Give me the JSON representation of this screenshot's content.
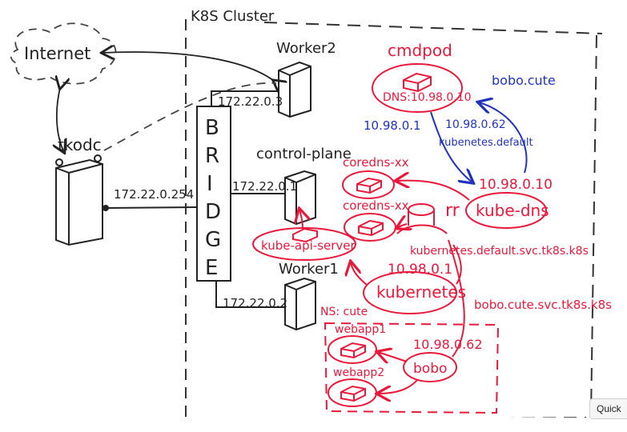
{
  "colors": {
    "ink": "#222222",
    "red": "#e8193c",
    "blue": "#2233bb",
    "dash": "#333333"
  },
  "cluster_label": "K8S Cluster",
  "internet": "Internet",
  "host": "tkodc",
  "host_ip": "172.22.0.254",
  "bridge": [
    "B",
    "R",
    "I",
    "D",
    "G",
    "E"
  ],
  "nodes": {
    "worker2": {
      "name": "Worker2",
      "ip": "172.22.0.3"
    },
    "control_plane": {
      "name": "control-plane",
      "ip": "172.22.0.1"
    },
    "worker1": {
      "name": "Worker1",
      "ip": "172.22.0.2"
    }
  },
  "pods": {
    "cmdpod": {
      "name": "cmdpod",
      "dns": "DNS:10.98.0.10"
    },
    "coredns1": "coredns-xx",
    "coredns2": "coredns-xx",
    "kube_api": "kube-api-server",
    "webapp1": "webapp1",
    "webapp2": "webapp2"
  },
  "services": {
    "kube_dns": {
      "name": "kube-dns",
      "ip": "10.98.0.10"
    },
    "kubernetes": {
      "name": "kubernetes",
      "ip": "10.98.0.1"
    },
    "bobo": {
      "name": "bobo",
      "ip": "10.98.0.62"
    }
  },
  "annotations": {
    "ip_10_98_0_1": "10.98.0.1",
    "query_ip": "10.98.0.62",
    "query_name": "kubenetes.default",
    "bobo_cute": "bobo.cute",
    "rr": "rr",
    "kubernetes_fqdn": "kubernetes.default.svc.tk8s.k8s",
    "bobo_fqdn": "bobo.cute.svc.tk8s.k8s",
    "ns": "NS: cute"
  },
  "ui": {
    "quick_button": "Quick"
  }
}
